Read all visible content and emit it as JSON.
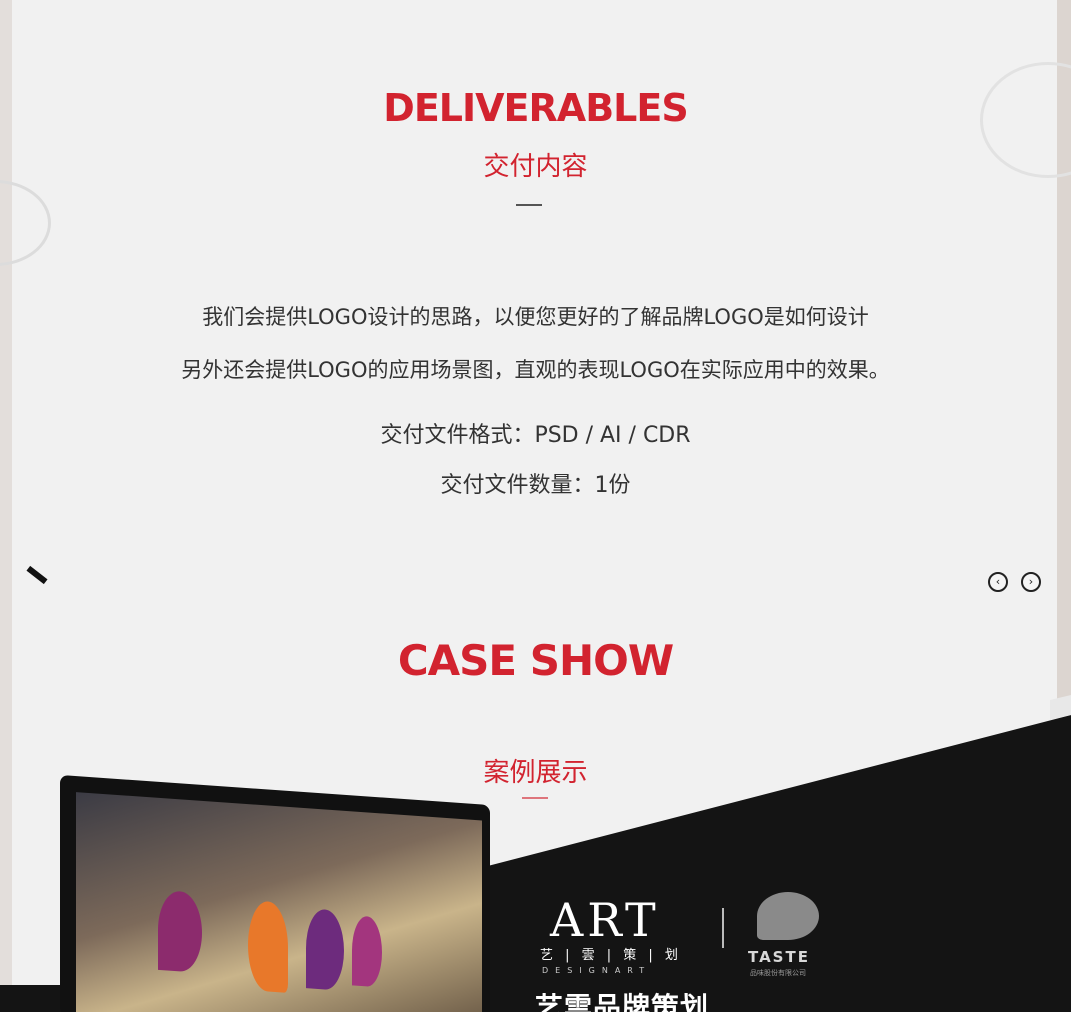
{
  "deliverables": {
    "title": "DELIVERABLES",
    "subtitle": "交付内容",
    "line1": "我们会提供LOGO设计的思路，以便您更好的了解品牌LOGO是如何设计",
    "line2": "另外还会提供LOGO的应用场景图，直观的表现LOGO在实际应用中的效果。",
    "format": "交付文件格式：PSD / AI / CDR",
    "quantity": "交付文件数量：1份"
  },
  "slider": {
    "prev_icon": "chevron-left-icon",
    "next_icon": "chevron-right-icon",
    "prev_glyph": "‹",
    "next_glyph": "›"
  },
  "case_show": {
    "title": "CASE SHOW",
    "subtitle": "案例展示"
  },
  "showcase": {
    "art_logo": "ART",
    "art_cn": "艺 | 雲 | 策 | 划",
    "art_en": "DESIGNART",
    "taste_logo": "TASTE",
    "taste_sub": "品味股份有限公司",
    "brand_line": "艺雲品牌策划"
  },
  "colors": {
    "accent": "#d2232f",
    "dark_band": "#141414",
    "page_bg": "#f1f1f1"
  }
}
